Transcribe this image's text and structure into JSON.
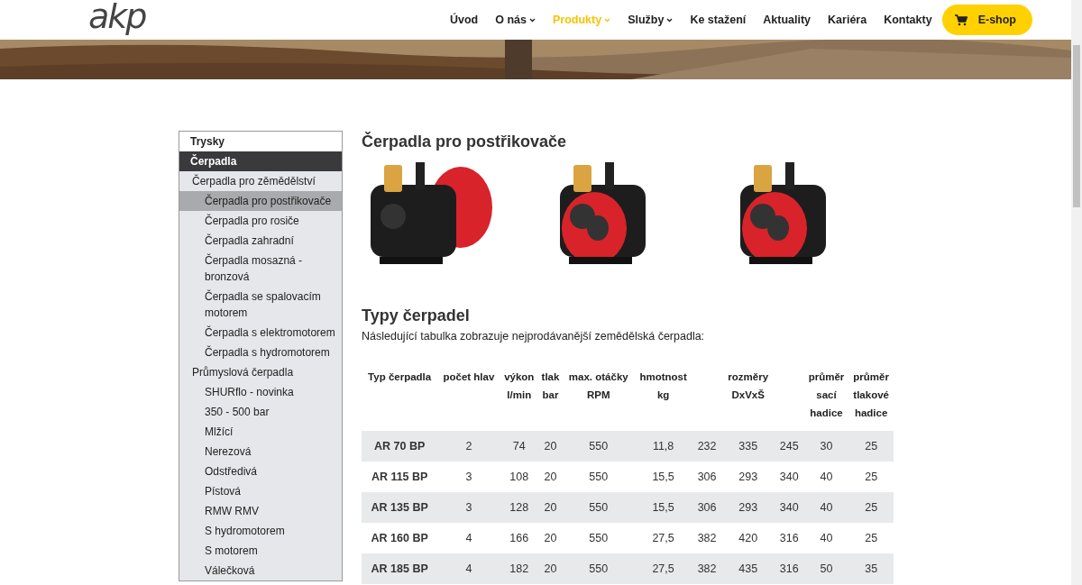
{
  "header": {
    "logo": "akp",
    "nav": [
      {
        "label": "Úvod",
        "selected": false,
        "dropdown": false
      },
      {
        "label": "O nás",
        "selected": false,
        "dropdown": true
      },
      {
        "label": "Produkty",
        "selected": true,
        "dropdown": true
      },
      {
        "label": "Služby",
        "selected": false,
        "dropdown": true
      },
      {
        "label": "Ke stažení",
        "selected": false,
        "dropdown": false
      },
      {
        "label": "Aktuality",
        "selected": false,
        "dropdown": false
      },
      {
        "label": "Kariéra",
        "selected": false,
        "dropdown": false
      },
      {
        "label": "Kontakty",
        "selected": false,
        "dropdown": false
      }
    ],
    "shop_button": "E-shop"
  },
  "sidebar": {
    "items": [
      {
        "label": "Trysky",
        "selected": false
      },
      {
        "label": "Čerpadla",
        "selected": true,
        "children": [
          {
            "label": "Čerpadla pro zěmědělství",
            "selected": false,
            "children": [
              {
                "label": "Čerpadla pro postřikovače",
                "selected": true
              },
              {
                "label": "Čerpadla pro rosiče",
                "selected": false
              },
              {
                "label": "Čerpadla zahradní",
                "selected": false
              },
              {
                "label": "Čerpadla mosazná - bronzová",
                "selected": false
              },
              {
                "label": "Čerpadla se spalovacím motorem",
                "selected": false
              },
              {
                "label": "Čerpadla s elektromotorem",
                "selected": false
              },
              {
                "label": "Čerpadla s hydromotorem",
                "selected": false
              }
            ]
          },
          {
            "label": "Průmyslová čerpadla",
            "selected": false,
            "children": [
              {
                "label": "SHURflo - novinka",
                "selected": false
              },
              {
                "label": "350 - 500 bar",
                "selected": false
              },
              {
                "label": "Mlžící",
                "selected": false
              },
              {
                "label": "Nerezová",
                "selected": false
              },
              {
                "label": "Odstředivá",
                "selected": false
              },
              {
                "label": "Pístová",
                "selected": false
              },
              {
                "label": "RMW RMV",
                "selected": false
              },
              {
                "label": "S hydromotorem",
                "selected": false
              },
              {
                "label": "S motorem",
                "selected": false
              },
              {
                "label": "Válečková",
                "selected": false
              }
            ]
          }
        ]
      }
    ]
  },
  "content": {
    "title": "Čerpadla pro postřikovače",
    "subtitle": "Typy čerpadel",
    "intro": "Následující tabulka zobrazuje nejprodávanější zemědělská čerpadla:",
    "table": {
      "columns": [
        "Typ čerpadla",
        "počet hlav",
        "výkon\nl/min",
        "tlak\nbar",
        "max. otáčky\nRPM",
        "hmotnost\nkg",
        "rozměry\nDxVxŠ",
        "průměr\nsací\nhadice",
        "průměr\ntlakové\nhadice"
      ],
      "rows": [
        [
          "AR 70 BP",
          "2",
          "74",
          "20",
          "550",
          "11,8",
          [
            "232",
            "335",
            "245"
          ],
          "30",
          "25"
        ],
        [
          "AR 115 BP",
          "3",
          "108",
          "20",
          "550",
          "15,5",
          [
            "306",
            "293",
            "340"
          ],
          "40",
          "25"
        ],
        [
          "AR 135 BP",
          "3",
          "128",
          "20",
          "550",
          "15,5",
          [
            "306",
            "293",
            "340"
          ],
          "40",
          "25"
        ],
        [
          "AR 160 BP",
          "4",
          "166",
          "20",
          "550",
          "27,5",
          [
            "382",
            "420",
            "316"
          ],
          "40",
          "25"
        ],
        [
          "AR 185 BP",
          "4",
          "182",
          "20",
          "550",
          "27,5",
          [
            "382",
            "435",
            "316"
          ],
          "50",
          "35"
        ]
      ]
    }
  }
}
